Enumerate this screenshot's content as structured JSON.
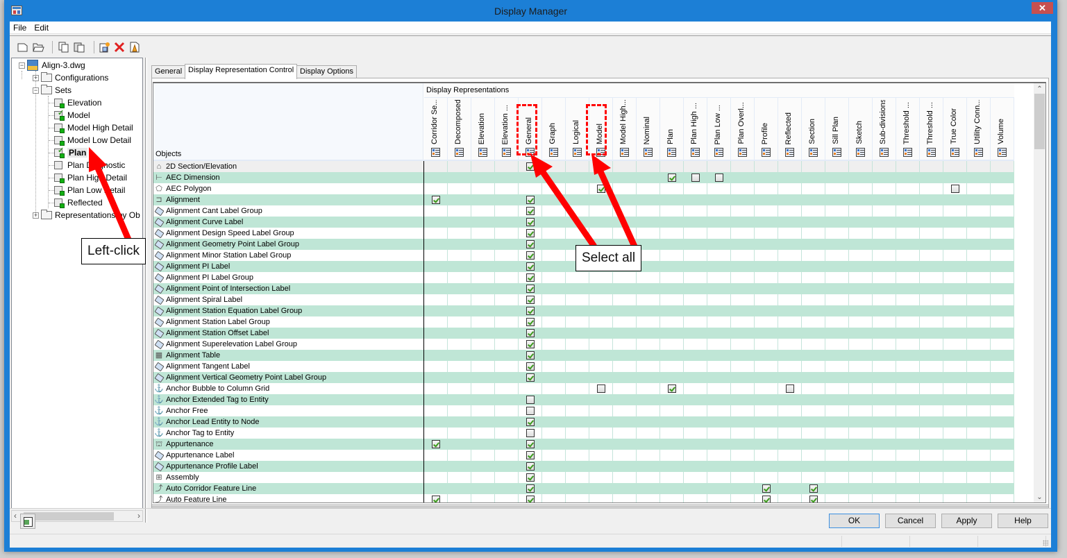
{
  "window": {
    "title": "Display Manager",
    "close_label": "✕"
  },
  "menu": [
    "File",
    "Edit"
  ],
  "toolbar": [
    {
      "name": "new-icon"
    },
    {
      "name": "open-icon"
    },
    {
      "name": "copy-icon"
    },
    {
      "name": "paste-icon"
    },
    {
      "name": "new-set-icon"
    },
    {
      "name": "delete-icon"
    },
    {
      "name": "purge-icon"
    }
  ],
  "tree": {
    "root": "Align-3.dwg",
    "configurations": "Configurations",
    "sets": "Sets",
    "set_items": [
      {
        "label": "Elevation",
        "active": false,
        "checked": false
      },
      {
        "label": "Model",
        "active": false,
        "checked": true
      },
      {
        "label": "Model High Detail",
        "active": false,
        "checked": false
      },
      {
        "label": "Model Low Detail",
        "active": false,
        "checked": false
      },
      {
        "label": "Plan",
        "active": true,
        "checked": true
      },
      {
        "label": "Plan Diagnostic",
        "active": false,
        "checked": false,
        "no_badge": true
      },
      {
        "label": "Plan High Detail",
        "active": false,
        "checked": false
      },
      {
        "label": "Plan Low Detail",
        "active": false,
        "checked": false
      },
      {
        "label": "Reflected",
        "active": false,
        "checked": false
      }
    ],
    "representations": "Representations by Ob"
  },
  "tabs": [
    {
      "label": "General",
      "active": false
    },
    {
      "label": "Display Representation Control",
      "active": true
    },
    {
      "label": "Display Options",
      "active": false
    }
  ],
  "grid": {
    "objects_header": "Objects",
    "group_header": "Display Representations",
    "columns": [
      "Corridor Se...",
      "Decomposed",
      "Elevation",
      "Elevation ...",
      "General",
      "Graph",
      "Logical",
      "Model",
      "Model High...",
      "Nominal",
      "Plan",
      "Plan High ...",
      "Plan Low ...",
      "Plan Overl...",
      "Profile",
      "Reflected",
      "Section",
      "Sill Plan",
      "Sketch",
      "Sub-divisions",
      "Threshold ...",
      "Threshold ...",
      "True Color",
      "Utility Conn...",
      "Volume"
    ],
    "rows": [
      {
        "label": "2D Section/Elevation",
        "icon": "section-elevation-icon",
        "glyph": "⌂",
        "cells": {
          "4": true
        }
      },
      {
        "label": "AEC Dimension",
        "icon": "dimension-icon",
        "glyph": "⊢",
        "cells": {
          "10": true,
          "11": false,
          "12": false
        }
      },
      {
        "label": "AEC Polygon",
        "icon": "polygon-icon",
        "glyph": "⬠",
        "cells": {
          "7": true,
          "22": false
        }
      },
      {
        "label": "Alignment",
        "icon": "alignment-icon",
        "glyph": "⊐",
        "cells": {
          "0": true,
          "4": true
        }
      },
      {
        "label": "Alignment Cant Label Group",
        "icon": "label-tag-icon",
        "cells": {
          "4": true
        }
      },
      {
        "label": "Alignment Curve Label",
        "icon": "label-tag-icon",
        "cells": {
          "4": true
        }
      },
      {
        "label": "Alignment Design Speed Label Group",
        "icon": "label-tag-icon",
        "cells": {
          "4": true
        }
      },
      {
        "label": "Alignment Geometry Point Label Group",
        "icon": "label-tag-icon",
        "cells": {
          "4": true
        }
      },
      {
        "label": "Alignment Minor Station Label Group",
        "icon": "label-tag-icon",
        "cells": {
          "4": true
        }
      },
      {
        "label": "Alignment PI Label",
        "icon": "label-tag-icon",
        "cells": {
          "4": true
        }
      },
      {
        "label": "Alignment PI Label Group",
        "icon": "label-tag-icon",
        "cells": {
          "4": true
        }
      },
      {
        "label": "Alignment Point of Intersection Label",
        "icon": "label-tag-icon",
        "cells": {
          "4": true
        }
      },
      {
        "label": "Alignment Spiral Label",
        "icon": "label-tag-icon",
        "cells": {
          "4": true
        }
      },
      {
        "label": "Alignment Station Equation Label Group",
        "icon": "label-tag-icon",
        "cells": {
          "4": true
        }
      },
      {
        "label": "Alignment Station Label Group",
        "icon": "label-tag-icon",
        "cells": {
          "4": true
        }
      },
      {
        "label": "Alignment Station Offset Label",
        "icon": "label-tag-icon",
        "cells": {
          "4": true
        }
      },
      {
        "label": "Alignment Superelevation Label Group",
        "icon": "label-tag-icon",
        "cells": {
          "4": true
        }
      },
      {
        "label": "Alignment Table",
        "icon": "table-icon",
        "glyph": "▦",
        "cells": {
          "4": true
        }
      },
      {
        "label": "Alignment Tangent Label",
        "icon": "label-tag-icon",
        "cells": {
          "4": true
        }
      },
      {
        "label": "Alignment Vertical Geometry Point Label Group",
        "icon": "label-tag-icon",
        "cells": {
          "4": true
        }
      },
      {
        "label": "Anchor Bubble to Column Grid",
        "icon": "anchor-icon",
        "glyph": "⚓",
        "cells": {
          "7": false,
          "10": true,
          "15": false
        }
      },
      {
        "label": "Anchor Extended Tag to Entity",
        "icon": "anchor-icon",
        "glyph": "⚓",
        "cells": {
          "4": false
        }
      },
      {
        "label": "Anchor Free",
        "icon": "anchor-icon",
        "glyph": "⚓",
        "cells": {
          "4": false
        }
      },
      {
        "label": "Anchor Lead Entity to Node",
        "icon": "anchor-icon",
        "glyph": "⚓",
        "cells": {
          "4": true
        }
      },
      {
        "label": "Anchor Tag to Entity",
        "icon": "anchor-icon",
        "glyph": "⚓",
        "cells": {
          "4": false
        }
      },
      {
        "label": "Appurtenance",
        "icon": "appurtenance-icon",
        "glyph": "⛫",
        "cells": {
          "0": true,
          "4": true
        }
      },
      {
        "label": "Appurtenance Label",
        "icon": "label-tag-icon",
        "cells": {
          "4": true
        }
      },
      {
        "label": "Appurtenance Profile Label",
        "icon": "label-tag-icon",
        "cells": {
          "4": true
        }
      },
      {
        "label": "Assembly",
        "icon": "assembly-icon",
        "glyph": "⊞",
        "cells": {
          "4": true
        }
      },
      {
        "label": "Auto Corridor Feature Line",
        "icon": "feature-line-icon",
        "glyph": "⤴",
        "cells": {
          "4": true,
          "14": true,
          "16": true
        }
      },
      {
        "label": "Auto Feature Line",
        "icon": "feature-line-icon",
        "glyph": "⤴",
        "cells": {
          "0": true,
          "4": true,
          "14": true,
          "16": true
        }
      }
    ]
  },
  "buttons": {
    "ok": "OK",
    "cancel": "Cancel",
    "apply": "Apply",
    "help": "Help"
  },
  "annotations": {
    "left_click": "Left-click",
    "select_all": "Select all"
  },
  "colors": {
    "titlebar": "#1c7fd6",
    "row_alt": "#bfe6d6",
    "check": "#3a9a1a",
    "annotation": "#ff0000",
    "close": "#c75050"
  }
}
